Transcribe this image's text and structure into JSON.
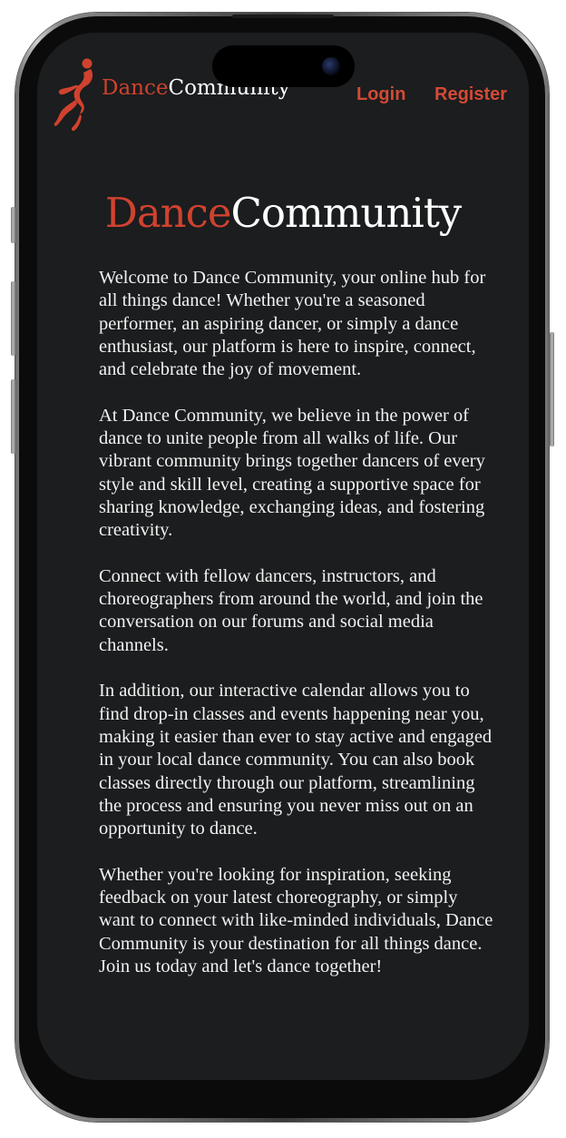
{
  "header": {
    "brand_part1": "Dance",
    "brand_part2": "Community",
    "logo_icon": "dancer-logo-icon",
    "nav": {
      "login_label": "Login",
      "register_label": "Register"
    }
  },
  "hero": {
    "title_part1": "Dance",
    "title_part2": "Community"
  },
  "paragraphs": [
    "Welcome to Dance Community, your online hub for all things dance! Whether you're a seasoned performer, an aspiring dancer, or simply a dance enthusiast, our platform is here to inspire, connect, and celebrate the joy of movement.",
    "At Dance Community, we believe in the power of dance to unite people from all walks of life. Our vibrant community brings together dancers of every style and skill level, creating a supportive space for sharing knowledge, exchanging ideas, and fostering creativity.",
    "Connect with fellow dancers, instructors, and choreographers from around the world, and join the conversation on our forums and social media channels.",
    "In addition, our interactive calendar allows you to find drop-in classes and events happening near you, making it easier than ever to stay active and engaged in your local dance community. You can also book classes directly through our platform, streamlining the process and ensuring you never miss out on an opportunity to dance.",
    "Whether you're looking for inspiration, seeking feedback on your latest choreography, or simply want to connect with like-minded individuals, Dance Community is your destination for all things dance. Join us today and let's dance together!"
  ],
  "colors": {
    "accent": "#d0422f",
    "background": "#1b1d1e",
    "text": "#f2f2f2"
  }
}
